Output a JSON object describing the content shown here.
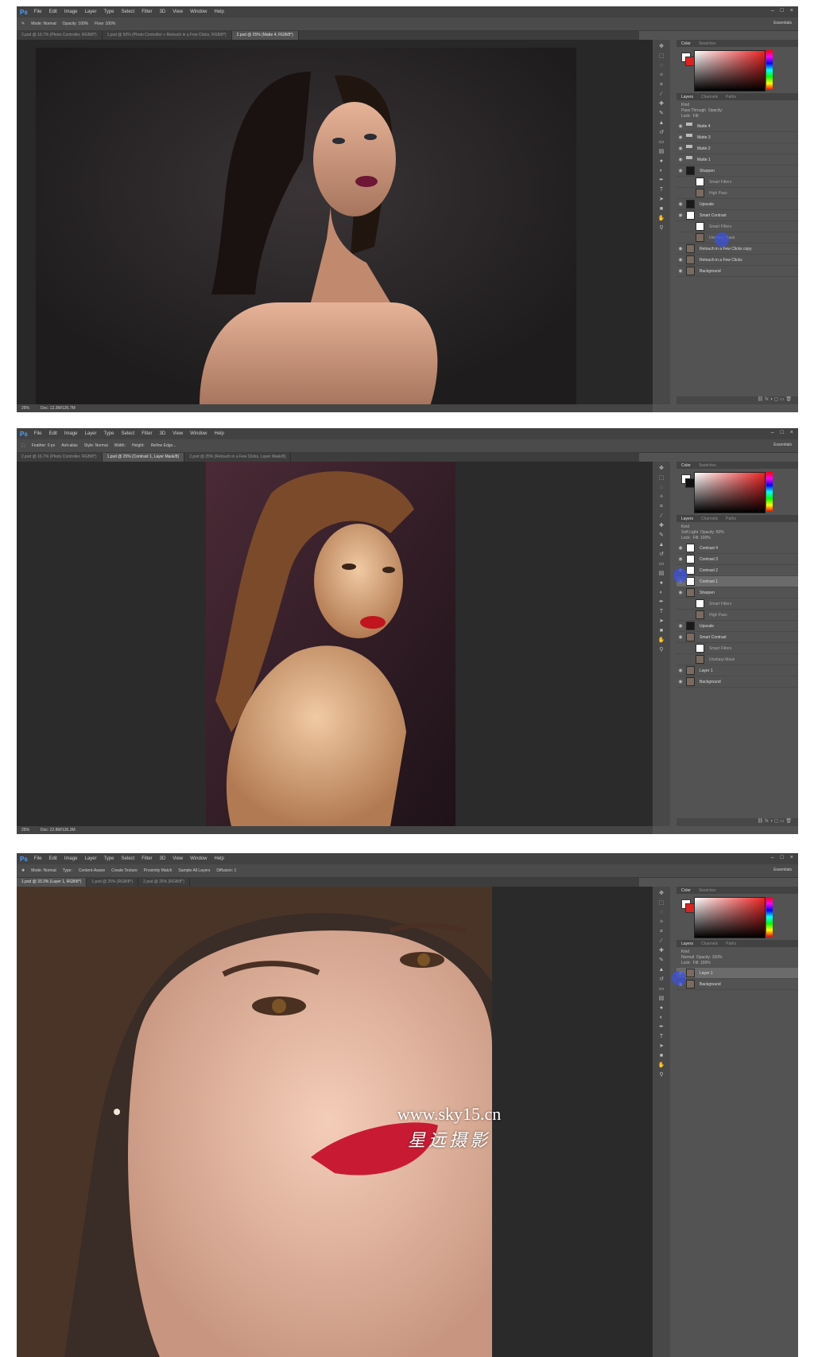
{
  "menu": [
    "File",
    "Edit",
    "Image",
    "Layer",
    "Type",
    "Select",
    "Filter",
    "3D",
    "View",
    "Window",
    "Help"
  ],
  "app_logo": "Ps",
  "workspace": "Essentials",
  "panel_tabs": {
    "color": "Color",
    "swatches": "Swatches",
    "layers": "Layers",
    "channels": "Channels",
    "paths": "Paths"
  },
  "layer_filter": "Kind",
  "window_controls": [
    "–",
    "□",
    "×"
  ],
  "screens": [
    {
      "options": [
        "Mode: Normal",
        "Opacity: 100%",
        "Flow: 100%"
      ],
      "tabs": [
        {
          "label": "2.psd @ 16.7% (Photo Controller, RGB/8*)",
          "active": false
        },
        {
          "label": "1.psd @ 50% (Photo Controller + Retouch in a Few Clicks, RGB/8*)",
          "active": false
        },
        {
          "label": "2.psd @ 25% (Matte 4, RGB/8*)",
          "active": true
        }
      ],
      "status": [
        "25%",
        "Doc: 12.3M/126.7M"
      ],
      "layer_opts": [
        "Pass Through",
        "Opacity:",
        "Lock:",
        "Fill:"
      ],
      "layers": [
        {
          "name": "Matte 4",
          "type": "group"
        },
        {
          "name": "Matte 3",
          "type": "group"
        },
        {
          "name": "Matte 2",
          "type": "group"
        },
        {
          "name": "Matte 1",
          "type": "group"
        },
        {
          "name": "Sharpen",
          "type": "layer",
          "thumb": "dark"
        },
        {
          "name": "Smart Filters",
          "type": "sub",
          "thumb": "white"
        },
        {
          "name": "High Pass",
          "type": "sub"
        },
        {
          "name": "Upscale",
          "type": "layer",
          "thumb": "dark"
        },
        {
          "name": "Smart Contrast",
          "type": "layer",
          "thumb": "white"
        },
        {
          "name": "Smart Filters",
          "type": "sub",
          "thumb": "white"
        },
        {
          "name": "Unsharp Mask",
          "type": "sub"
        },
        {
          "name": "Retouch in a Few Clicks copy",
          "type": "layer"
        },
        {
          "name": "Retouch in a Few Clicks",
          "type": "layer"
        },
        {
          "name": "Background",
          "type": "layer"
        }
      ]
    },
    {
      "options": [
        "Feather: 0 px",
        "Anti-alias",
        "Style: Normal",
        "Width:",
        "Height:",
        "Refine Edge..."
      ],
      "tabs": [
        {
          "label": "2.psd @ 16.7% (Photo Controller, RGB/8*)",
          "active": false
        },
        {
          "label": "1.psd @ 25% (Contrast 1, Layer Mask/8)",
          "active": true
        },
        {
          "label": "2.psd @ 25% (Retouch in a Few Clicks, Layer Mask/8)",
          "active": false
        }
      ],
      "status": [
        "25%",
        "Doc: 22.8M/136.3M"
      ],
      "layer_opts": [
        "Soft Light",
        "Opacity: 50%",
        "Lock:",
        "Fill: 100%"
      ],
      "layers": [
        {
          "name": "Contrast 4",
          "type": "layer",
          "thumb": "white"
        },
        {
          "name": "Contrast 3",
          "type": "layer",
          "thumb": "white"
        },
        {
          "name": "Contrast 2",
          "type": "layer",
          "thumb": "white"
        },
        {
          "name": "Contrast 1",
          "type": "layer",
          "thumb": "white",
          "selected": true
        },
        {
          "name": "Sharpen",
          "type": "layer"
        },
        {
          "name": "Smart Filters",
          "type": "sub",
          "thumb": "white"
        },
        {
          "name": "High Pass",
          "type": "sub"
        },
        {
          "name": "Upscale",
          "type": "layer",
          "thumb": "dark"
        },
        {
          "name": "Smart Contrast",
          "type": "layer"
        },
        {
          "name": "Smart Filters",
          "type": "sub",
          "thumb": "white"
        },
        {
          "name": "Unsharp Mask",
          "type": "sub"
        },
        {
          "name": "Layer 1",
          "type": "layer"
        },
        {
          "name": "Background",
          "type": "layer"
        }
      ]
    },
    {
      "options": [
        "Mode: Normal",
        "Type:",
        "Content-Aware",
        "Create Texture",
        "Proximity Match",
        "Sample All Layers",
        "Diffusion: 1"
      ],
      "tabs": [
        {
          "label": "1.psd @ 33.3% (Layer 1, RGB/8*)",
          "active": true
        },
        {
          "label": "1.psd @ 25% (RGB/8*)",
          "active": false
        },
        {
          "label": "2.psd @ 25% (RGB/8*)",
          "active": false
        }
      ],
      "status": [],
      "layer_opts": [
        "Normal",
        "Opacity: 100%",
        "Lock:",
        "Fill: 100%"
      ],
      "layers": [
        {
          "name": "Layer 1",
          "type": "layer",
          "selected": true
        },
        {
          "name": "Background",
          "type": "layer"
        }
      ]
    }
  ],
  "watermark": {
    "url": "www.sky15.cn",
    "cn": "星远摄影"
  },
  "tool_icons": [
    "move-icon",
    "marquee-icon",
    "lasso-icon",
    "quick-select-icon",
    "crop-icon",
    "eyedropper-icon",
    "healing-icon",
    "brush-icon",
    "stamp-icon",
    "history-brush-icon",
    "eraser-icon",
    "gradient-icon",
    "blur-icon",
    "dodge-icon",
    "pen-icon",
    "type-icon",
    "path-select-icon",
    "shape-icon",
    "hand-icon",
    "zoom-icon"
  ]
}
